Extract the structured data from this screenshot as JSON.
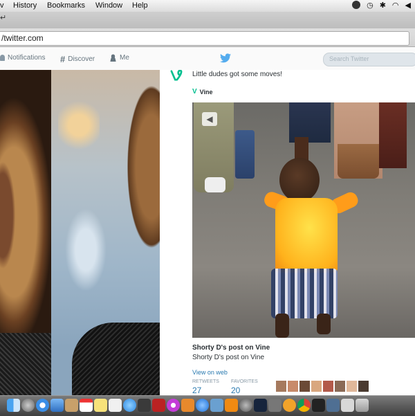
{
  "menubar": {
    "items": [
      "History",
      "Bookmarks",
      "Window",
      "Help"
    ]
  },
  "browser": {
    "url": "/twitter.com"
  },
  "twitter_nav": {
    "notifications": "Notifications",
    "discover": "Discover",
    "me": "Me",
    "search_placeholder": "Search Twitter"
  },
  "tweet": {
    "text": "Little dudes got some moves!",
    "source": "Vine",
    "card_title": "Shorty D's post on Vine",
    "card_description": "Shorty D's post on Vine",
    "view_on_web": "View on web",
    "retweets_label": "RETWEETS",
    "retweets_count": "27",
    "favorites_label": "FAVORITES",
    "favorites_count": "20"
  },
  "colors": {
    "twitter_blue": "#55acee",
    "vine_green": "#00bf8f",
    "link_blue": "#2a7ab0"
  }
}
